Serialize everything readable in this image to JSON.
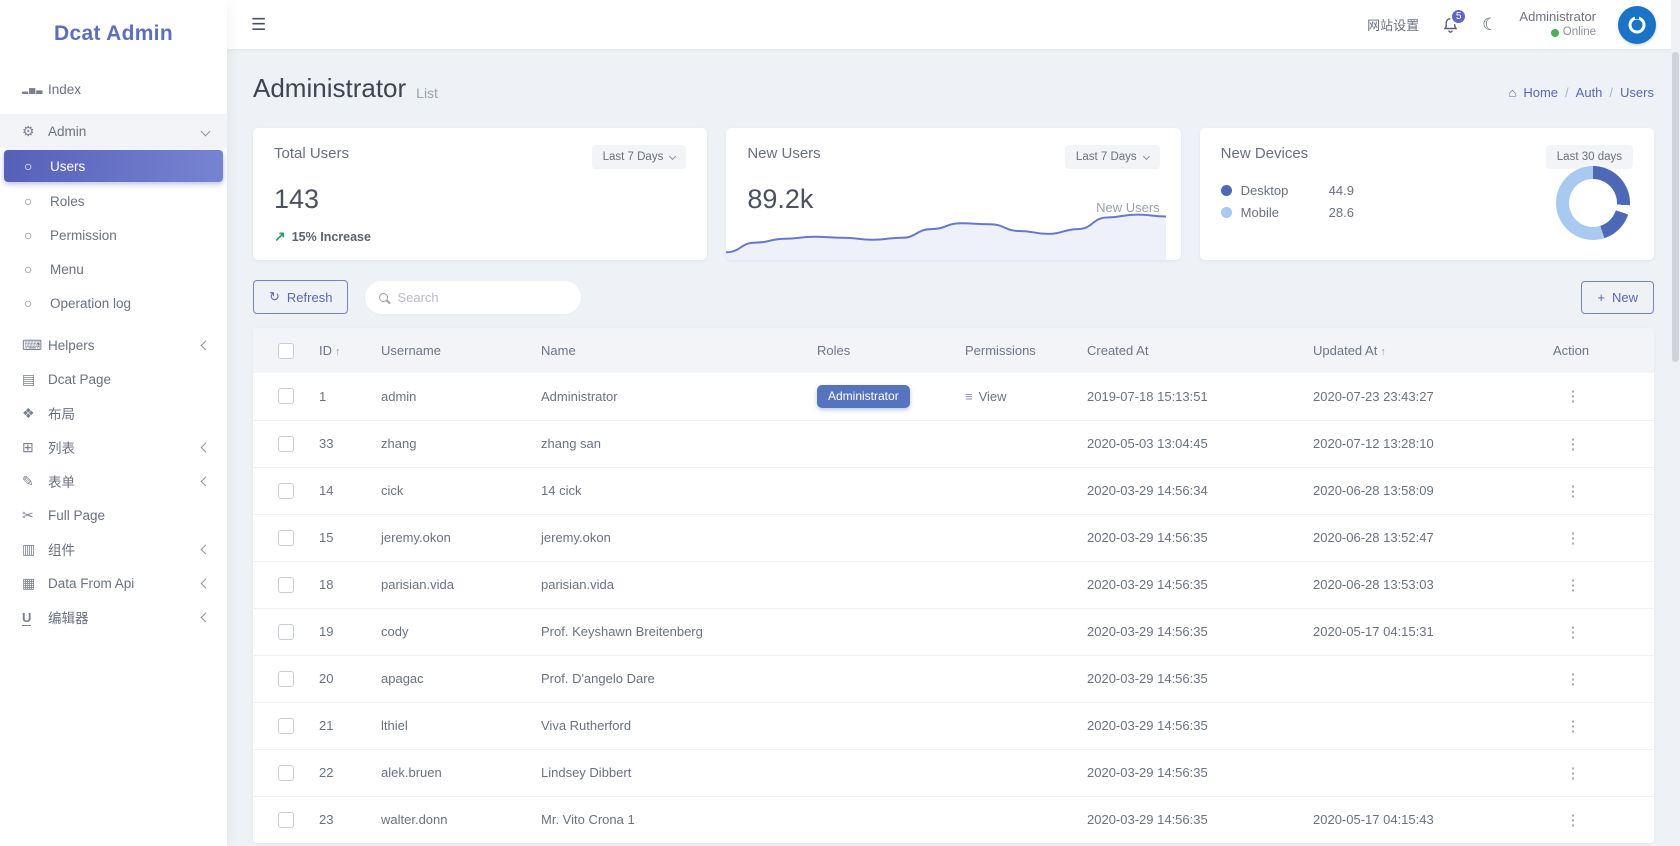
{
  "sidebar": {
    "logo": "Dcat Admin",
    "items": [
      {
        "name": "index",
        "icon": "chart-bar-icon",
        "label": "Index",
        "chevron": null,
        "active": false,
        "sub": false,
        "group_open": false
      },
      {
        "name": "admin",
        "icon": "gear-icon",
        "label": "Admin",
        "chevron": "down",
        "active": false,
        "sub": false,
        "group_open": true
      },
      {
        "name": "users",
        "icon": "circle-icon",
        "label": "Users",
        "chevron": null,
        "active": true,
        "sub": true,
        "group_open": false
      },
      {
        "name": "roles",
        "icon": "circle-icon",
        "label": "Roles",
        "chevron": null,
        "active": false,
        "sub": true,
        "group_open": false
      },
      {
        "name": "permission",
        "icon": "circle-icon",
        "label": "Permission",
        "chevron": null,
        "active": false,
        "sub": true,
        "group_open": false
      },
      {
        "name": "menu",
        "icon": "circle-icon",
        "label": "Menu",
        "chevron": null,
        "active": false,
        "sub": true,
        "group_open": false
      },
      {
        "name": "operation-log",
        "icon": "circle-icon",
        "label": "Operation log",
        "chevron": null,
        "active": false,
        "sub": true,
        "group_open": false
      },
      {
        "name": "helpers",
        "icon": "keyboard-icon",
        "label": "Helpers",
        "chevron": "left",
        "active": false,
        "sub": false,
        "group_open": false
      },
      {
        "name": "dcat-page",
        "icon": "file-icon",
        "label": "Dcat Page",
        "chevron": null,
        "active": false,
        "sub": false,
        "group_open": false
      },
      {
        "name": "layout",
        "icon": "blocks-icon",
        "label": "布局",
        "chevron": null,
        "active": false,
        "sub": false,
        "group_open": false
      },
      {
        "name": "list",
        "icon": "grid-icon",
        "label": "列表",
        "chevron": "left",
        "active": false,
        "sub": false,
        "group_open": false
      },
      {
        "name": "form",
        "icon": "edit-icon",
        "label": "表单",
        "chevron": "left",
        "active": false,
        "sub": false,
        "group_open": false
      },
      {
        "name": "full-page",
        "icon": "scissors-icon",
        "label": "Full Page",
        "chevron": null,
        "active": false,
        "sub": false,
        "group_open": false
      },
      {
        "name": "component",
        "icon": "component-icon",
        "label": "组件",
        "chevron": "left",
        "active": false,
        "sub": false,
        "group_open": false
      },
      {
        "name": "data-from-api",
        "icon": "film-icon",
        "label": "Data From Api",
        "chevron": "left",
        "active": false,
        "sub": false,
        "group_open": false
      },
      {
        "name": "editor",
        "icon": "underline-icon",
        "label": "编辑器",
        "chevron": "left",
        "active": false,
        "sub": false,
        "group_open": false
      }
    ]
  },
  "topbar": {
    "settings_label": "网站设置",
    "notification_count": "5",
    "user_name": "Administrator",
    "user_status": "Online"
  },
  "page": {
    "title": "Administrator",
    "subtitle": "List",
    "breadcrumb": [
      "Home",
      "Auth",
      "Users"
    ]
  },
  "cards": {
    "total_users": {
      "title": "Total Users",
      "period": "Last 7 Days",
      "value": "143",
      "trend": "15% Increase"
    },
    "new_users": {
      "title": "New Users",
      "period": "Last 7 Days",
      "value": "89.2k",
      "side_label": "New Users"
    },
    "new_devices": {
      "title": "New Devices",
      "period": "Last 30 days",
      "legend": [
        {
          "label": "Desktop",
          "value": "44.9",
          "color": "#4d68b4"
        },
        {
          "label": "Mobile",
          "value": "28.6",
          "color": "#a8c9f0"
        }
      ]
    }
  },
  "chart_data": [
    {
      "type": "area",
      "title": "New Users sparkline",
      "x": [
        0,
        1,
        2,
        3,
        4,
        5,
        6,
        7,
        8,
        9,
        10,
        11,
        12,
        13,
        14,
        15
      ],
      "values": [
        8,
        18,
        22,
        24,
        23,
        21,
        23,
        32,
        38,
        37,
        30,
        27,
        32,
        44,
        47,
        45
      ],
      "line_color": "#6579cc",
      "fill_color": "rgba(101,121,204,0.10)",
      "legend_position": "none",
      "grid": false
    },
    {
      "type": "pie",
      "title": "New Devices",
      "labels": [
        "Desktop",
        "Mobile"
      ],
      "values": [
        44.9,
        28.6
      ],
      "colors": [
        "#4d68b4",
        "#a8c9f0"
      ],
      "period": "Last 30 days",
      "legend_position": "left"
    }
  ],
  "toolbar": {
    "refresh_label": "Refresh",
    "search_placeholder": "Search",
    "new_label": "New"
  },
  "table": {
    "columns": [
      {
        "label": "",
        "sort": false
      },
      {
        "label": "ID",
        "sort": true
      },
      {
        "label": "Username",
        "sort": false
      },
      {
        "label": "Name",
        "sort": false
      },
      {
        "label": "Roles",
        "sort": false
      },
      {
        "label": "Permissions",
        "sort": false
      },
      {
        "label": "Created At",
        "sort": false
      },
      {
        "label": "Updated At",
        "sort": true
      },
      {
        "label": "Action",
        "sort": false
      }
    ],
    "rows": [
      {
        "id": "1",
        "username": "admin",
        "name": "Administrator",
        "roles": [
          "Administrator"
        ],
        "permission": "View",
        "created_at": "2019-07-18 15:13:51",
        "updated_at": "2020-07-23 23:43:27"
      },
      {
        "id": "33",
        "username": "zhang",
        "name": "zhang san",
        "roles": [],
        "permission": "",
        "created_at": "2020-05-03 13:04:45",
        "updated_at": "2020-07-12 13:28:10"
      },
      {
        "id": "14",
        "username": "cick",
        "name": "14 cick",
        "roles": [],
        "permission": "",
        "created_at": "2020-03-29 14:56:34",
        "updated_at": "2020-06-28 13:58:09"
      },
      {
        "id": "15",
        "username": "jeremy.okon",
        "name": "jeremy.okon",
        "roles": [],
        "permission": "",
        "created_at": "2020-03-29 14:56:35",
        "updated_at": "2020-06-28 13:52:47"
      },
      {
        "id": "18",
        "username": "parisian.vida",
        "name": "parisian.vida",
        "roles": [],
        "permission": "",
        "created_at": "2020-03-29 14:56:35",
        "updated_at": "2020-06-28 13:53:03"
      },
      {
        "id": "19",
        "username": "cody",
        "name": "Prof. Keyshawn Breitenberg",
        "roles": [],
        "permission": "",
        "created_at": "2020-03-29 14:56:35",
        "updated_at": "2020-05-17 04:15:31"
      },
      {
        "id": "20",
        "username": "apagac",
        "name": "Prof. D'angelo Dare",
        "roles": [],
        "permission": "",
        "created_at": "2020-03-29 14:56:35",
        "updated_at": ""
      },
      {
        "id": "21",
        "username": "lthiel",
        "name": "Viva Rutherford",
        "roles": [],
        "permission": "",
        "created_at": "2020-03-29 14:56:35",
        "updated_at": ""
      },
      {
        "id": "22",
        "username": "alek.bruen",
        "name": "Lindsey Dibbert",
        "roles": [],
        "permission": "",
        "created_at": "2020-03-29 14:56:35",
        "updated_at": ""
      },
      {
        "id": "23",
        "username": "walter.donn",
        "name": "Mr. Vito Crona 1",
        "roles": [],
        "permission": "",
        "created_at": "2020-03-29 14:56:35",
        "updated_at": "2020-05-17 04:15:43"
      }
    ]
  },
  "colors": {
    "accent": "#5b69bd",
    "badge": "#5674bd",
    "online": "#4caf50",
    "avatar_blue": "#1a73c7",
    "notification_badge": "#5f66c9",
    "trend_green": "#2e9e6b"
  }
}
